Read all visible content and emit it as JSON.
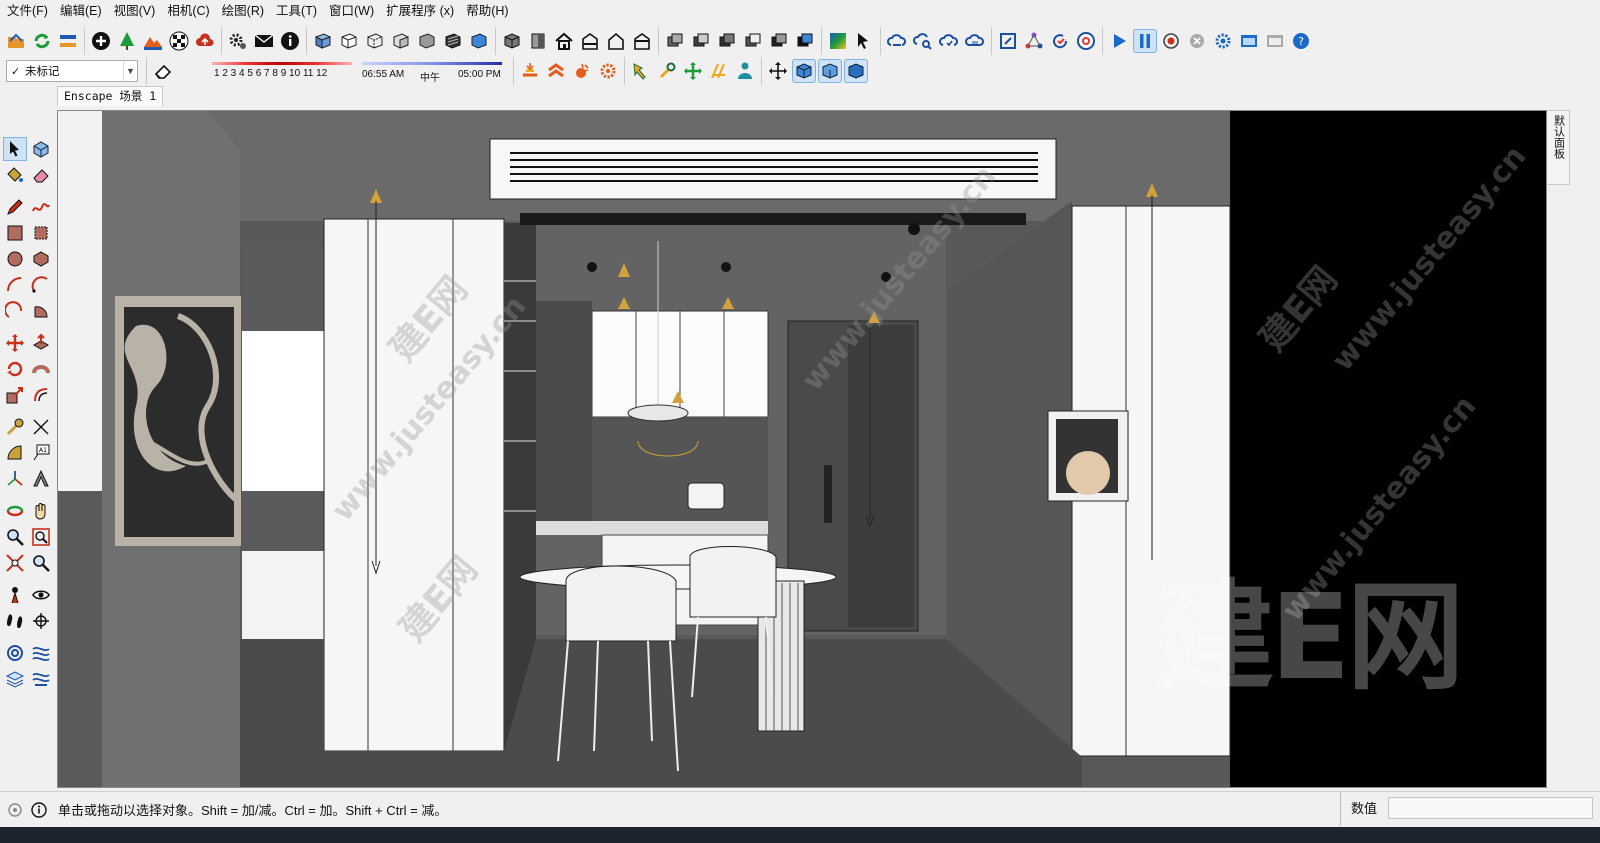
{
  "menu": [
    "文件(F)",
    "编辑(E)",
    "视图(V)",
    "相机(C)",
    "绘图(R)",
    "工具(T)",
    "窗口(W)",
    "扩展程序 (x)",
    "帮助(H)"
  ],
  "tag_dropdown": {
    "selected": "未标记"
  },
  "shadow": {
    "months": "1 2 3 4 5 6 7 8 9 10 11 12",
    "time_start": "06:55 AM",
    "time_mid": "中午",
    "time_end": "05:00 PM"
  },
  "scene_tabs": [
    "Enscape 场景 1"
  ],
  "right_panel": {
    "label": "默认面板"
  },
  "viewport": {
    "watermark_big": "建E网",
    "watermark_small": "www.justeasy.cn",
    "watermark_logo": "建E网"
  },
  "status": {
    "message": "单击或拖动以选择对象。Shift = 加/减。Ctrl = 加。Shift + Ctrl = 减。",
    "vcb_label": "数值",
    "vcb_value": ""
  },
  "icons": {
    "toolbar1": [
      "open-icon",
      "reload-icon",
      "swap-icon",
      "add-icon",
      "tree-icon",
      "terrain-icon",
      "checker-icon",
      "cloud-upload-icon",
      "gear-icon",
      "mail-icon",
      "info-icon",
      "box-face-icon",
      "box-outline-icon",
      "box-cut-icon",
      "box-shade-icon",
      "box-flat-icon",
      "box-dark-icon",
      "box-blue-icon",
      "cube-front-icon",
      "cube-side-icon",
      "home-icon",
      "home-front-icon",
      "home-outline-icon",
      "home-back-icon",
      "layer-stack-icon",
      "layer-stack-2-icon",
      "layer-stack-3-icon",
      "layer-stack-4-icon",
      "layer-stack-5-icon",
      "layer-stack-6-icon",
      "color-palette-icon",
      "select-cursor-icon",
      "cloud-link-icon",
      "cloud-search-icon",
      "cloud-sync-icon",
      "cloud-stack-icon",
      "frame-icon",
      "network-icon",
      "refresh-check-icon",
      "chrome-icon",
      "play-icon",
      "pause-icon",
      "record-icon",
      "stop-icon",
      "settings-icon",
      "window-icon",
      "window-gray-icon",
      "help-icon"
    ],
    "toolbar2": [
      "eraser-icon",
      "shadow-slider",
      "sun-orange-icon",
      "sun-red-icon",
      "sun-rays-icon",
      "gear-orange-icon",
      "pin-icon",
      "wrench-icon",
      "move-cross-icon",
      "ruler-icon",
      "person-icon",
      "orbit-icon",
      "cube-blue-icon",
      "cube-blue-2-icon",
      "cube-blue-3-icon"
    ]
  },
  "colors": {
    "accent": "#1b6ac9",
    "viewport_bg": "#595959",
    "right_bg": "#000000"
  }
}
